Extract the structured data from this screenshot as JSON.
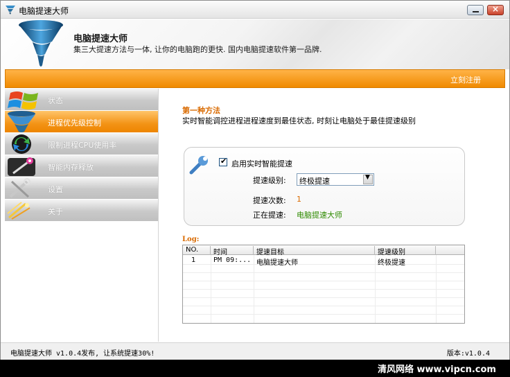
{
  "window": {
    "title": "电脑提速大师"
  },
  "header": {
    "app_name": "电脑提速大师",
    "slogan": "集三大提速方法与一体, 让你的电脑跑的更快. 国内电脑提速软件第一品牌."
  },
  "toolbar": {
    "register_label": "立刻注册"
  },
  "sidebar": {
    "items": [
      {
        "label": "状态",
        "active": false
      },
      {
        "label": "进程优先级控制",
        "active": true
      },
      {
        "label": "限制进程CPU使用率",
        "active": false
      },
      {
        "label": "智能内存释放",
        "active": false
      },
      {
        "label": "设置",
        "active": false
      },
      {
        "label": "关于",
        "active": false
      }
    ]
  },
  "main": {
    "method_title": "第一种方法",
    "method_desc": "实时智能调控进程进程速度到最佳状态, 时刻让电脑处于最佳提速级别",
    "panel": {
      "checkbox_label": "启用实时智能提速",
      "checkbox_checked": true,
      "level_label": "提速级别:",
      "level_value": "终极提速",
      "count_label": "提速次数:",
      "count_value": "1",
      "current_label": "正在提速:",
      "current_value": "电脑提速大师"
    },
    "log": {
      "label": "Log:",
      "columns": [
        "NO.",
        "时间",
        "提速目标",
        "提速级别"
      ],
      "rows": [
        [
          "1",
          "PM 09:...",
          "电脑提速大师",
          "终极提速"
        ]
      ]
    }
  },
  "statusbar": {
    "left": "电脑提速大师 v1.0.4发布, 让系统提速30%!",
    "right": "版本:v1.0.4"
  },
  "watermark": "清风网络 www.vipcn.com",
  "colors": {
    "accent_orange": "#f39316",
    "label_orange": "#d96a00",
    "value_green": "#2e8b00"
  },
  "icons": {
    "app": "tornado-icon",
    "panel": "wrench-icon",
    "status": "windows-logo-icon",
    "priority": "tornado-icon",
    "cpu": "refresh-arrows-icon",
    "memory": "magic-wand-icon",
    "settings": "tools-icon",
    "about": "sparkle-icon"
  }
}
